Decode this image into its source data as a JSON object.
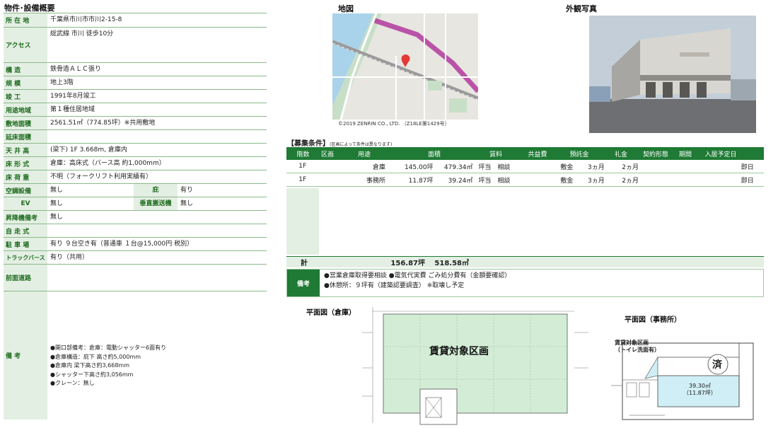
{
  "section_property": "物件･設備概要",
  "section_map": "地図",
  "section_photo": "外観写真",
  "map_copyright": "©2019 ZENRIN CO., LTD. （Z18LE第1429号）",
  "spec": {
    "location_label": "所 在 地",
    "location": "千葉県市川市市川2-15-8",
    "access_label": "アクセス",
    "access": "総武線 市川 徒歩10分",
    "structure_label": "構 造",
    "structure": "鉄骨造ＡＬＣ張り",
    "scale_label": "規 模",
    "scale": "地上3階",
    "built_label": "竣 工",
    "built": "1991年8月竣工",
    "zoning_label": "用途地域",
    "zoning": "第１種住居地域",
    "site_label": "敷地面積",
    "site": "2561.51㎡（774.85坪）※共用敷地",
    "floor_total_label": "延床面積",
    "floor_total": "",
    "ceiling_label": "天 井 高",
    "ceiling": "(梁下) 1F 3.668m, 倉庫内",
    "floor_type_label": "床 形 式",
    "floor_type": "倉庫：高床式（バース高 約1,000mm）",
    "load_label": "床 荷 重",
    "load": "不明（フォークリフト利用実績有）",
    "ac_label": "空調設備",
    "ac": "無し",
    "eaves_label": "庇",
    "eaves": "有り",
    "ev_label": "EV",
    "ev": "無し",
    "vertical_label": "垂直搬送機",
    "vertical": "無し",
    "lift_label": "昇降機備考",
    "lift": "無し",
    "selfrun_label": "自 走 式",
    "selfrun": "",
    "parking_label": "駐 車 場",
    "parking": "有り ９台空き有（普通車 １台@15,000円 税別）",
    "truck_label": "トラックバース",
    "truck": "有り（共用）",
    "road_label": "前面道路",
    "road": "",
    "remarks_label": "備 考",
    "remarks": [
      "●開口部備考：倉庫：電動シャッター6面有り",
      "●倉庫構造：庇下 高さ約5,000mm",
      "●倉庫内 梁下高さ約3,668mm",
      "●シャッター下高さ約3,056mm",
      "●クレーン：無し"
    ]
  },
  "recruit": {
    "title": "【募集条件】",
    "subtitle": "(区画によって条件は異なります)",
    "headers": [
      "階数",
      "区画",
      "用途",
      "面積",
      "",
      "賃料",
      "",
      "共益費",
      "預託金",
      "",
      "礼金",
      "契約形態",
      "期間",
      "入居予定日"
    ],
    "rows": [
      {
        "floor": "1F",
        "section": "",
        "use": "倉庫",
        "tsubo": "145.00坪",
        "sqm": "479.34㎡",
        "unit": "坪当",
        "rent": "相談",
        "common": "",
        "dep_l": "敷金",
        "dep": "3ヵ月",
        "key": "2ヵ月",
        "contract": "",
        "term": "",
        "move": "即日"
      },
      {
        "floor": "1F",
        "section": "",
        "use": "事務所",
        "tsubo": "11.87坪",
        "sqm": "39.24㎡",
        "unit": "坪当",
        "rent": "相談",
        "common": "",
        "dep_l": "敷金",
        "dep": "3ヵ月",
        "key": "2ヵ月",
        "contract": "",
        "term": "",
        "move": "即日"
      }
    ],
    "total_label": "計",
    "total_tsubo": "156.87坪",
    "total_sqm": "518.58㎡",
    "notes_label": "備考",
    "notes": [
      "●営業倉庫取得要相談 ●電気代実費 ごみ処分費有（金額要確認）",
      "●休憩所：９坪有（建築認要調査） ※取壊し予定"
    ]
  },
  "plan_warehouse_title": "平面図（倉庫）",
  "plan_warehouse_label": "賃貸対象区画",
  "plan_office_title": "平面図（事務所）",
  "plan_office_note1": "賃貸対象区画",
  "plan_office_note2": "（トイレ洗面有）",
  "plan_office_done": "済",
  "plan_office_area1": "39.30㎡",
  "plan_office_area2": "（11.87坪）",
  "colors": {
    "green_dark": "#1e7a34",
    "green_light": "#e4efe4",
    "plan_fill": "#d3ecd6"
  }
}
